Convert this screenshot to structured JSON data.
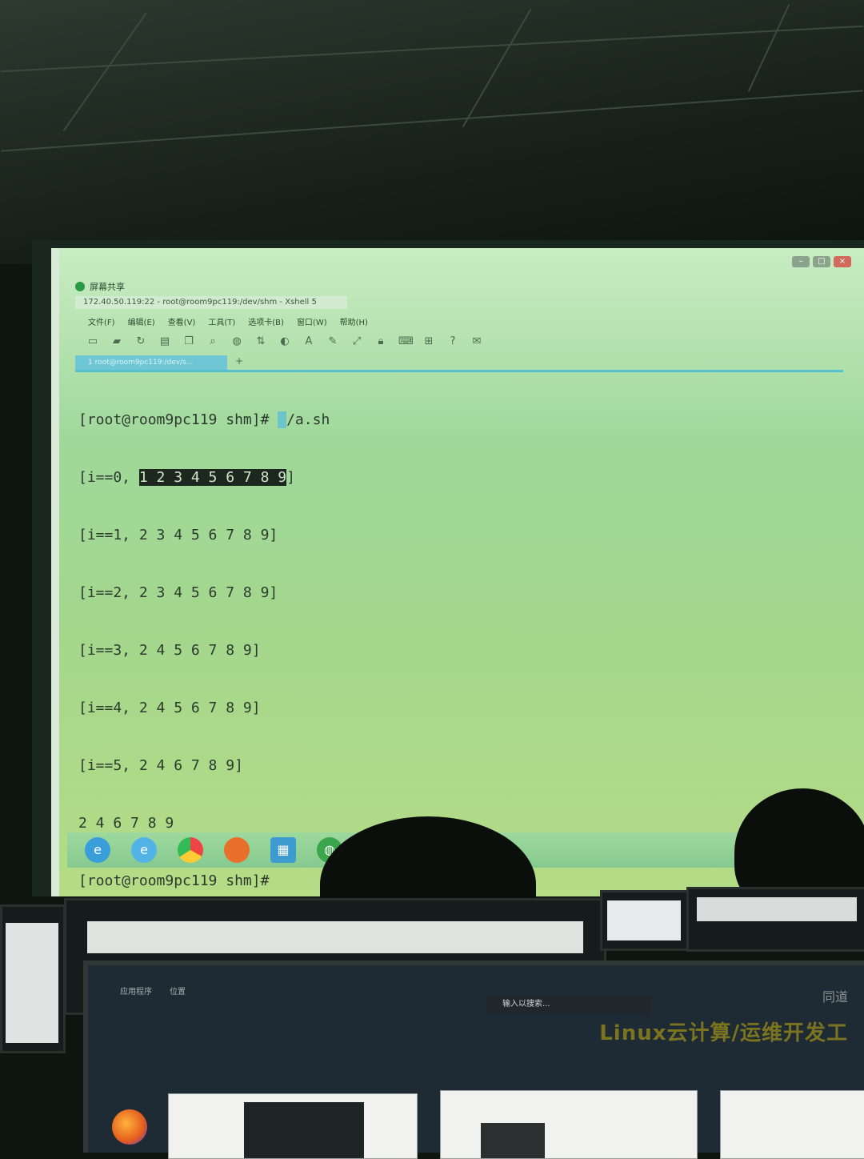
{
  "projection": {
    "window_title": "屏幕共享",
    "address": "172.40.50.119:22 - root@room9pc119:/dev/shm - Xshell 5",
    "menu": [
      "文件(F)",
      "编辑(E)",
      "查看(V)",
      "工具(T)",
      "选项卡(B)",
      "窗口(W)",
      "帮助(H)"
    ],
    "tab_label": "1 root@room9pc119:/dev/s...",
    "tab_add": "+",
    "terminal_lines": [
      {
        "pre": "[root@room9pc119 shm]# ",
        "cursor": ".",
        "post": "/a.sh"
      },
      {
        "pre": "[i==0, ",
        "hl": "1 2 3 4 5 6 7 8 9",
        "post": "]"
      },
      {
        "pre": "[i==1, 2 3 4 5 6 7 8 9]"
      },
      {
        "pre": "[i==2, 2 3 4 5 6 7 8 9]"
      },
      {
        "pre": "[i==3, 2 4 5 6 7 8 9]"
      },
      {
        "pre": "[i==4, 2 4 5 6 7 8 9]"
      },
      {
        "pre": "[i==5, 2 4 6 7 8 9]"
      },
      {
        "pre": "2 4 6 7 8 9"
      },
      {
        "pre": "[root@room9pc119 shm]#"
      }
    ],
    "taskbar_icons": [
      "ie-icon",
      "edge-icon",
      "chrome-icon",
      "firefox-icon",
      "folder-icon",
      "globe-icon"
    ]
  },
  "front_monitor": {
    "menu": [
      "应用程序",
      "位置"
    ],
    "search_placeholder": "输入以搜索...",
    "banner": "Linux云计算/运维开发工",
    "corner": "同道"
  },
  "colors": {
    "terminal_bg": "#a4d78c",
    "tab_accent": "#57c0d0",
    "highlight": "#1d271f"
  }
}
